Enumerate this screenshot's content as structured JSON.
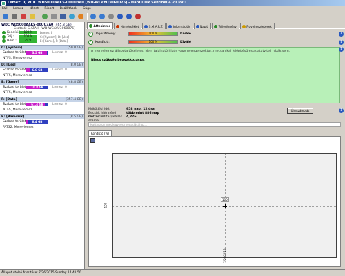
{
  "window": {
    "title": "Lemez: 0, WDC WD5000AAKS-00UU3A0 [WD-WCAYU3060076] - Hard Disk Sentinel 4.20 PRO"
  },
  "menu": [
    "Fájl",
    "Lemez",
    "Nézet",
    "Riport",
    "Beállítások",
    "Súgó"
  ],
  "disk": {
    "title": "WDC WD5000AAKS-00UU3A0",
    "size": "(465.8 GB)",
    "details": "Csatoló: S-ATA II [WD-WCAYU3060076]",
    "stats": [
      {
        "label": "Kondíció:",
        "value": "100 %",
        "extra": "Lemez: 0",
        "color": "#34b534"
      },
      {
        "label": "Telj.:",
        "value": "100 %",
        "extra": "C: [System], D: [Uss]",
        "color": "#34b534"
      },
      {
        "label": "Hőm.:",
        "value": "35 °C",
        "extra": "E: [Game], F: [Data]",
        "color": "#34b534"
      }
    ]
  },
  "partitions": [
    {
      "name": "C: [System]",
      "size": "(50.0 GB)",
      "free_label": "Szabad terület",
      "free": "3.5 GB",
      "fill": 0.93,
      "fill_color": "#c81ec8",
      "letter": "Lemez: 0",
      "fs": "NTFS, Merevlemez"
    },
    {
      "name": "D: [Uss]",
      "size": "(8.0 GB)",
      "free_label": "Szabad terület",
      "free": "6.6 GB",
      "fill": 0.18,
      "fill_color": "#c81ec8",
      "letter": "Lemez: 0",
      "fs": "NTFS, Merevlemez"
    },
    {
      "name": "E: [Game]",
      "size": "(48.8 GB)",
      "free_label": "Szabad terület",
      "free": "18.8 GB",
      "fill": 0.61,
      "fill_color": "#c81ec8",
      "letter": "Lemez: 0",
      "fs": "NTFS, Merevlemez"
    },
    {
      "name": "F: [Data]",
      "size": "(357.4 GB)",
      "free_label": "Szabad terület",
      "free": "61.4 GB",
      "fill": 0.83,
      "fill_color": "#c81ec8",
      "letter": "Lemez: 0",
      "fs": "NTFS, Merevlemez"
    },
    {
      "name": "R: [Ramdisk]",
      "size": "(8.5 GB)",
      "free_label": "Szabad terület",
      "free": "8.4 GB",
      "fill": 0.05,
      "fill_color": "#c81ec8",
      "letter": "",
      "fs": "FAT32, Merevlemez"
    }
  ],
  "tabs": [
    {
      "label": "Áttekintés",
      "color": "#2a8a2a"
    },
    {
      "label": "Hőmérséklet",
      "color": "#cc3300"
    },
    {
      "label": "S.M.A.R.T.",
      "color": "#2a5abf"
    },
    {
      "label": "Információk",
      "color": "#2a5abf"
    },
    {
      "label": "Napló",
      "color": "#2a5abf"
    },
    {
      "label": "Teljesítmény",
      "color": "#2a8a2a"
    },
    {
      "label": "Figyelmeztetések",
      "color": "#cc9900"
    }
  ],
  "health": [
    {
      "label": "Teljesítmény:",
      "value": "100 %",
      "result": "Kiváló"
    },
    {
      "label": "Kondíció:",
      "value": "100 %",
      "result": "Kiváló"
    }
  ],
  "summary": {
    "text": "A merevlemez állapota tökéletes. Nem található hibás vagy gyenge szektor, mecsanikai felépítésű és adatátviteli hibák sem.",
    "status": "Nincs szükség beavatkozásra."
  },
  "info": [
    {
      "key": "Működési idő:",
      "value": "958 nap, 12 óra"
    },
    {
      "key": "Becsült hátralévő élettartam:",
      "value": "több mint 886 nap"
    },
    {
      "key": "Összes indítás/leállás száma:",
      "value": "4,276"
    }
  ],
  "save_button": "Újraszámolás",
  "comment_placeholder": "Kattintson megjegyzés megadásához...",
  "chart_tab": "Kondíció (%)",
  "chart_data": {
    "type": "line",
    "x": [
      "7/26/2015"
    ],
    "series": [
      {
        "values": [
          100
        ]
      }
    ],
    "point_label": "100",
    "y_tick": "100",
    "x_tick": "7/26/2015"
  },
  "statusbar": "Állapot utolsó frissítése: 7/26/2015 Sunday 14:41:50"
}
